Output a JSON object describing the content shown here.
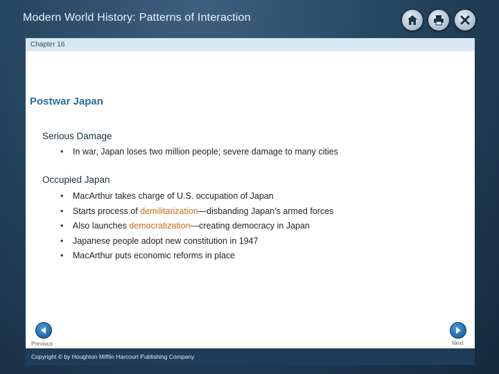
{
  "app": {
    "title": "Modern World History: Patterns of Interaction"
  },
  "toolbar": {
    "icons": [
      "home-icon",
      "print-icon",
      "close-icon"
    ]
  },
  "chapter": {
    "label": "Chapter 16"
  },
  "section": {
    "title": "Postwar Japan"
  },
  "topics": [
    {
      "heading": "Serious Damage",
      "bullets": [
        {
          "parts": [
            "In war, Japan loses two million people; severe damage to many cities"
          ]
        }
      ]
    },
    {
      "heading": "Occupied Japan",
      "bullets": [
        {
          "parts": [
            "MacArthur takes charge of U.S. occupation of Japan"
          ]
        },
        {
          "before": "Starts process of ",
          "term": "demilitarization",
          "after": "—disbanding Japan’s armed forces"
        },
        {
          "before": "Also launches ",
          "term": "democratization",
          "after": "—creating democracy in Japan"
        },
        {
          "parts": [
            "Japanese people adopt new constitution in 1947"
          ]
        },
        {
          "parts": [
            "MacArthur puts economic reforms in place"
          ]
        }
      ]
    }
  ],
  "nav": {
    "previous_label": "Previous",
    "next_label": "Next"
  },
  "footer": {
    "copyright": "Copyright © by Houghton Mifflin Harcourt Publishing Company"
  },
  "colors": {
    "accent_blue": "#2b6c9a",
    "highlight_orange": "#c96a14",
    "frame_dark": "#274661"
  }
}
